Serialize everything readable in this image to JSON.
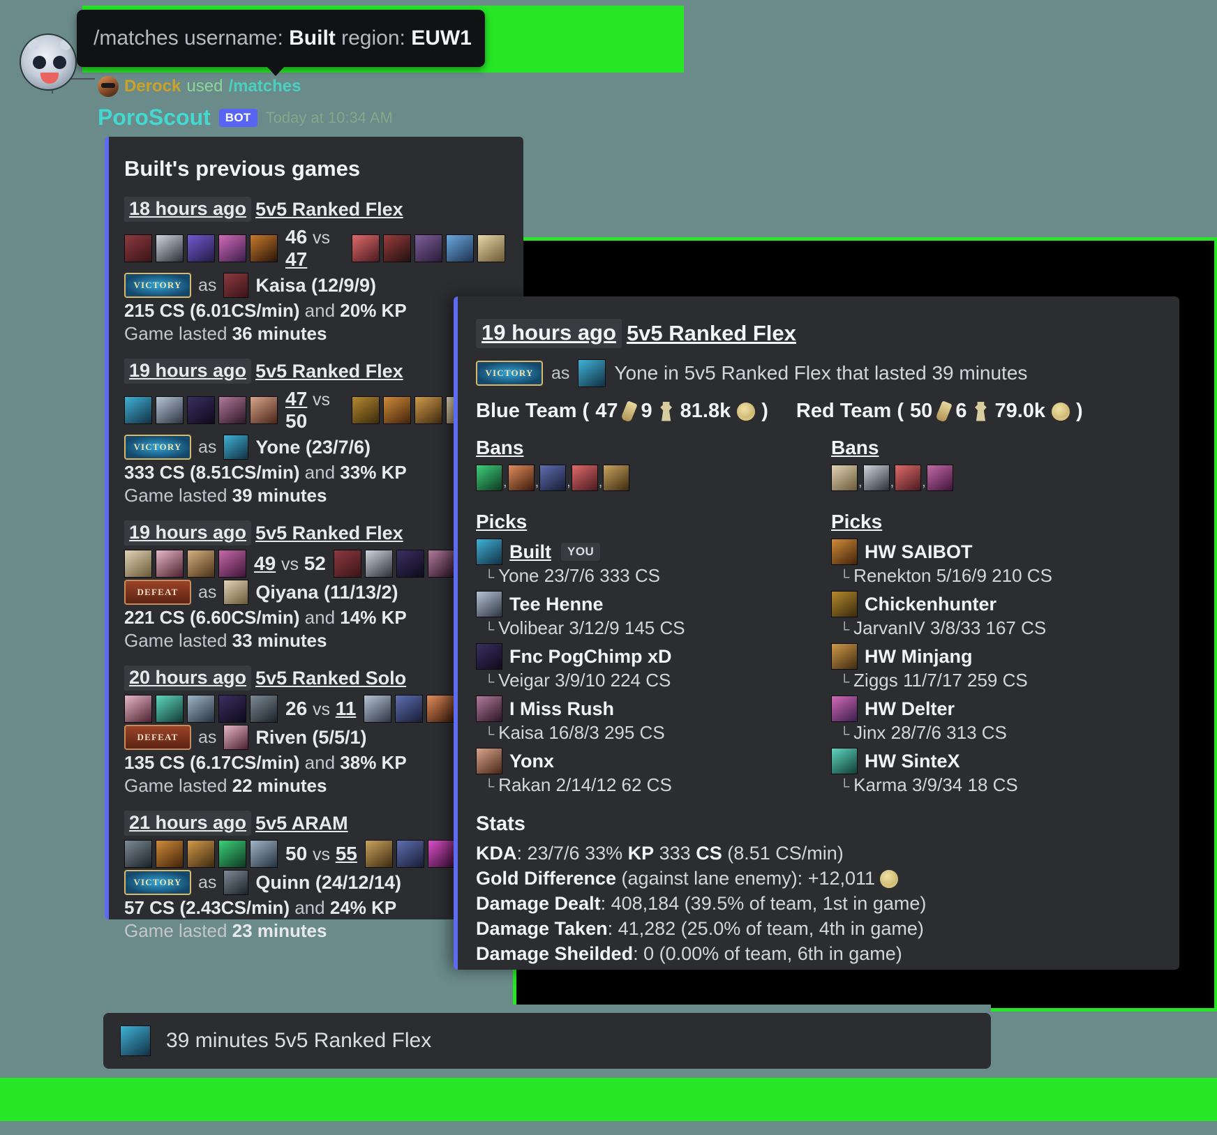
{
  "tooltip": {
    "prefix": "/matches username: ",
    "username": "Built",
    "mid": " region: ",
    "region": "EUW1"
  },
  "message": {
    "user": "Derock",
    "used": "used",
    "command": "/matches",
    "bot_name": "PoroScout",
    "bot_tag": "BOT",
    "timestamp": "Today at 10:34 AM"
  },
  "left_embed": {
    "title": "Built's previous games",
    "games": [
      {
        "when": "18 hours ago",
        "queue": "5v5 Ranked Flex",
        "blue_score": "46",
        "vs": "vs",
        "red_score": "47",
        "winner": "red",
        "result": "VICTORY",
        "as": "as",
        "champion": "Kaisa (12/9/9)",
        "cs": "215 CS (6.01CS/min)",
        "and": "and",
        "kp": "20% KP",
        "duration_prefix": "Game lasted",
        "duration": "36 minutes",
        "blue_champs": [
          "c1",
          "c2",
          "c3",
          "c4",
          "c5"
        ],
        "red_champs": [
          "c6",
          "c7",
          "c8",
          "c9",
          "c10"
        ]
      },
      {
        "when": "19 hours ago",
        "queue": "5v5 Ranked Flex",
        "blue_score": "47",
        "vs": "vs",
        "red_score": "50",
        "winner": "blue",
        "result": "VICTORY",
        "as": "as",
        "champion": "Yone (23/7/6)",
        "cs": "333 CS (8.51CS/min)",
        "and": "and",
        "kp": "33% KP",
        "duration_prefix": "Game lasted",
        "duration": "39 minutes",
        "blue_champs": [
          "c11",
          "c12",
          "c13",
          "c14",
          "c15"
        ],
        "red_champs": [
          "c16",
          "c17",
          "c18",
          "c19",
          "c20"
        ]
      },
      {
        "when": "19 hours ago",
        "queue": "5v5 Ranked Flex",
        "blue_score": "49",
        "vs": "vs",
        "red_score": "52",
        "winner": "blue",
        "result": "DEFEAT",
        "as": "as",
        "champion": "Qiyana (11/13/2)",
        "cs": "221 CS (6.60CS/min)",
        "and": "and",
        "kp": "14% KP",
        "duration_prefix": "Game lasted",
        "duration": "33 minutes",
        "blue_champs": [
          "c19",
          "c20",
          "c28",
          "c26"
        ],
        "red_champs": [
          "c1",
          "c2",
          "c13",
          "c14",
          "c29"
        ]
      },
      {
        "when": "20 hours ago",
        "queue": "5v5 Ranked Solo",
        "blue_score": "26",
        "vs": "vs",
        "red_score": "11",
        "winner": "red",
        "result": "DEFEAT",
        "as": "as",
        "champion": "Riven (5/5/1)",
        "cs": "135 CS (6.17CS/min)",
        "and": "and",
        "kp": "38% KP",
        "duration_prefix": "Game lasted",
        "duration": "22 minutes",
        "blue_champs": [
          "c20",
          "c29",
          "c31",
          "c13",
          "c24"
        ],
        "red_champs": [
          "c12",
          "c22",
          "c30",
          "c14"
        ]
      },
      {
        "when": "21 hours ago",
        "queue": "5v5 ARAM",
        "blue_score": "50",
        "vs": "vs",
        "red_score": "55",
        "winner": "red",
        "result": "VICTORY",
        "as": "as",
        "champion": "Quinn (24/12/14)",
        "cs": "57 CS (2.43CS/min)",
        "and": "and",
        "kp": "24% KP",
        "duration_prefix": "Game lasted",
        "duration": "23 minutes",
        "blue_champs": [
          "c24",
          "c17",
          "c18",
          "c23",
          "c31"
        ],
        "red_champs": [
          "c25",
          "c22",
          "c27",
          "c28"
        ]
      }
    ]
  },
  "right_embed": {
    "when": "19 hours ago",
    "queue": "5v5 Ranked Flex",
    "result_badge": "VICTORY",
    "as": "as",
    "summary": "Yone in 5v5 Ranked Flex that lasted 39 minutes",
    "blue_team": {
      "label": "Blue Team (",
      "kills": "47",
      "towers": "9",
      "gold": "81.8k",
      "close": ")",
      "bans_title": "Bans",
      "bans": [
        "c23",
        "c30",
        "c22",
        "c6",
        "c25"
      ],
      "picks_title": "Picks",
      "picks": [
        {
          "player": "Built",
          "you": "YOU",
          "champ_icon": "c11",
          "line": "Yone 23/7/6 333 CS"
        },
        {
          "player": "Tee Henne",
          "champ_icon": "c12",
          "line": "Volibear 3/12/9 145 CS"
        },
        {
          "player": "Fnc PogChimp xD",
          "champ_icon": "c13",
          "line": "Veigar 3/9/10 224 CS"
        },
        {
          "player": "I Miss Rush",
          "champ_icon": "c14",
          "line": "Kaisa 16/8/3 295 CS"
        },
        {
          "player": "Yonx",
          "champ_icon": "c15",
          "line": "Rakan 2/14/12 62 CS"
        }
      ]
    },
    "red_team": {
      "label": "Red Team (",
      "kills": "50",
      "towers": "6",
      "gold": "79.0k",
      "close": ")",
      "bans_title": "Bans",
      "bans": [
        "c19",
        "c2",
        "c6",
        "c26"
      ],
      "picks_title": "Picks",
      "picks": [
        {
          "player": "HW SAIBOT",
          "champ_icon": "c17",
          "line": "Renekton 5/16/9 210 CS"
        },
        {
          "player": "Chickenhunter",
          "champ_icon": "c16",
          "line": "JarvanIV 3/8/33 167 CS"
        },
        {
          "player": "HW Minjang",
          "champ_icon": "c18",
          "line": "Ziggs 11/7/17 259 CS"
        },
        {
          "player": "HW Delter",
          "champ_icon": "c4",
          "line": "Jinx 28/7/6 313 CS"
        },
        {
          "player": "HW SinteX",
          "champ_icon": "c29",
          "line": "Karma 3/9/34 18 CS"
        }
      ]
    },
    "stats": {
      "title": "Stats",
      "kda_label": "KDA",
      "kda_value": ": 23/7/6 33% ",
      "kp_label": "KP",
      "cs_value": " 333 ",
      "cs_label": "CS",
      "cs_rate": " (8.51 CS/min)",
      "gold_label": "Gold Difference",
      "gold_value": " (against lane enemy): +12,011",
      "dmg_dealt_label": "Damage Dealt",
      "dmg_dealt_value": ": 408,184 (39.5% of team, 1st in game)",
      "dmg_taken_label": "Damage Taken",
      "dmg_taken_value": ": 41,282 (25.0% of team, 4th in game)",
      "dmg_shield_label": "Damage Sheilded",
      "dmg_shield_value": ": 0 (0.00% of team, 6th in game)"
    }
  },
  "footer": {
    "text": "39 minutes 5v5 Ranked Flex"
  }
}
